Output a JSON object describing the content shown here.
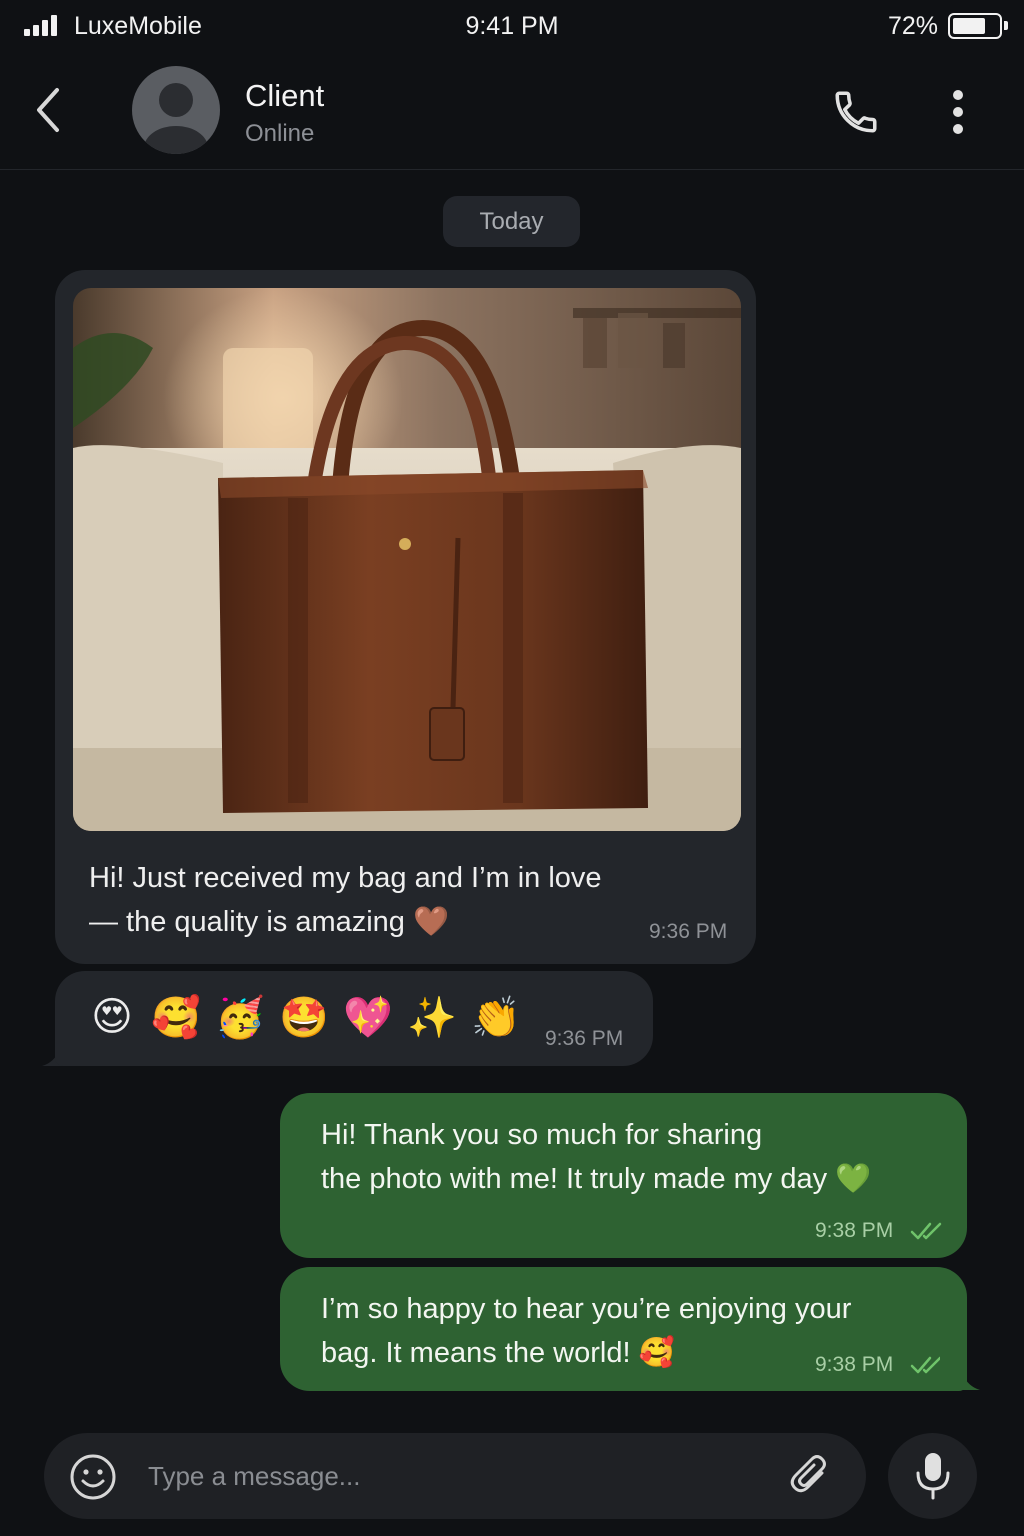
{
  "status_bar": {
    "carrier": "LuxeMobile",
    "time": "9:41 PM",
    "battery_percent": "72%",
    "battery_level": 0.72
  },
  "header": {
    "contact_name": "Client",
    "contact_status": "Online",
    "icons": [
      "chevron-left-icon",
      "avatar",
      "phone-icon",
      "more-vertical-icon"
    ]
  },
  "chat": {
    "date_separator": "Today",
    "messages": [
      {
        "direction": "incoming",
        "has_image": true,
        "image_subject": "brown leather tote bag on a sofa",
        "text_line1": "Hi! Just received my bag and I’m in love",
        "text_line2": "— the quality is amazing",
        "emoji": "🤎",
        "time": "9:36 PM"
      },
      {
        "direction": "incoming",
        "emojis": [
          "😍",
          "🥰",
          "🥳",
          "🤩",
          "💖",
          "✨",
          "👏"
        ],
        "time": "9:36 PM"
      },
      {
        "direction": "outgoing",
        "text_line1": "Hi! Thank you so much for sharing",
        "text_line2": "the photo with me! It truly made my day",
        "emoji": "💚",
        "time": "9:38 PM",
        "read": true
      },
      {
        "direction": "outgoing",
        "text_line1": "I’m so happy to hear you’re enjoying your",
        "text_line2": "bag. It means the world!",
        "emoji": "🥰",
        "time": "9:38 PM",
        "read": true
      }
    ]
  },
  "composer": {
    "placeholder": "Type a message..."
  },
  "colors": {
    "background": "#0f1114",
    "incoming_bubble": "#23262b",
    "outgoing_bubble": "#2e6232",
    "read_tick": "#6fc36a"
  }
}
